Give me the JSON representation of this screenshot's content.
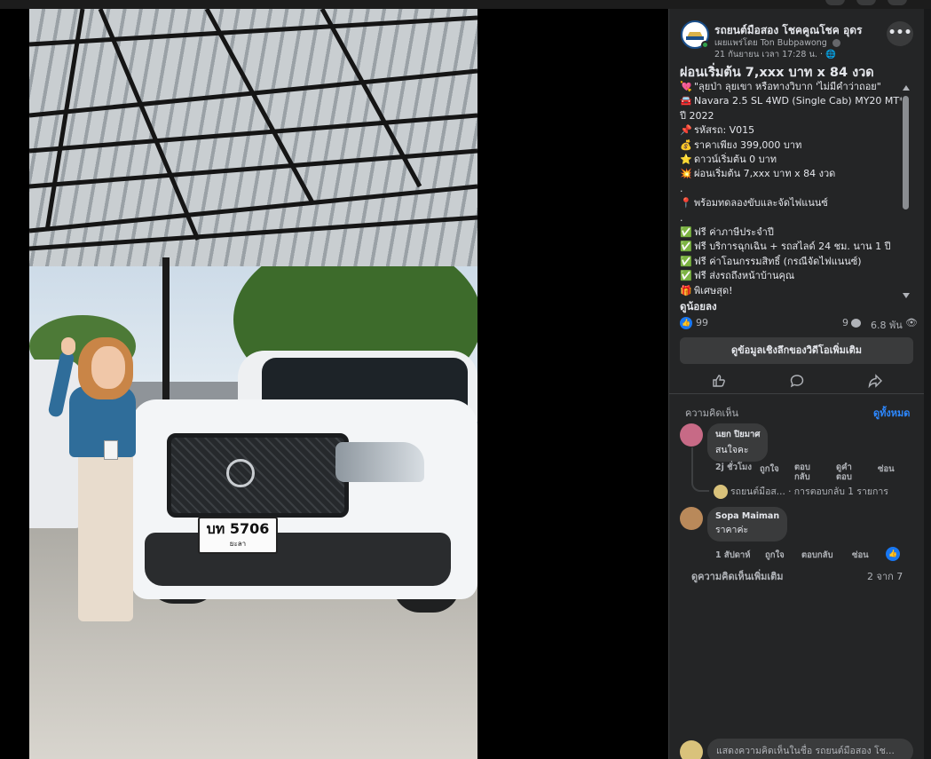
{
  "post": {
    "page_name": "รถยนต์มือสอง โชคคูณโชค อุดร",
    "published_by": "เผยแพร่โดย Ton Bubpawong",
    "timestamp": "21 กันยายน เวลา 17:28 น. ·",
    "title": "ผ่อนเริ่มต้น 7,xxx บาท x 84 งวด",
    "more_label": "•••",
    "see_less": "ดูน้อยลง",
    "lines": [
      {
        "icon": "💘",
        "text": "\"ลุยป่า ลุยเขา หรือทางวิบาก 'ไม่มีคำว่าถอย\""
      },
      {
        "icon": "🚘",
        "text": "Navara 2.5 SL 4WD (Single Cab) MY20 MT*"
      },
      {
        "icon": "",
        "text": "ปี 2022"
      },
      {
        "icon": "📌",
        "text": "รหัสรถ: V015"
      },
      {
        "icon": "💰",
        "text": "ราคาเพียง 399,000 บาท"
      },
      {
        "icon": "⭐",
        "text": "ดาวน์เริ่มต้น 0 บาท"
      },
      {
        "icon": "💥",
        "text": "ผ่อนเริ่มต้น 7,xxx บาท x 84 งวด"
      },
      {
        "icon": "",
        "text": "."
      },
      {
        "icon": "📍",
        "text": "พร้อมทดลองขับและจัดไฟแนนซ์"
      },
      {
        "icon": "",
        "text": "."
      },
      {
        "icon": "✅",
        "text": "ฟรี ค่าภาษีประจำปี"
      },
      {
        "icon": "✅",
        "text": "ฟรี บริการฉุกเฉิน + รถสไลด์ 24 ชม. นาน 1 ปี"
      },
      {
        "icon": "✅",
        "text": "ฟรี ค่าโอนกรรมสิทธิ์ (กรณีจัดไฟแนนซ์)"
      },
      {
        "icon": "✅",
        "text": "ฟรี ส่งรถถึงหน้าบ้านคุณ"
      },
      {
        "icon": "🎁",
        "text": "พิเศษสุด!"
      }
    ]
  },
  "stats": {
    "likes": "99",
    "comments": "9",
    "views": "6.8 พัน",
    "like_icon": "👍",
    "eye_icon": "👁"
  },
  "insight_button": "ดูข้อมูลเชิงลึกของวิดีโอเพิ่มเติม",
  "comments_section": {
    "header": "ความคิดเห็น",
    "see_all": "ดูทั้งหมด",
    "items": [
      {
        "name": "นยก ปิยมาศ",
        "text": "สนใจคะ",
        "meta": [
          "2j ชั่วโมง",
          "ถูกใจ",
          "ตอบกลับ",
          "ดูคำตอบ",
          "ซ่อน"
        ]
      },
      {
        "name": "Sopa Maiman",
        "text": "ราคาค่ะ",
        "meta": [
          "1 สัปดาห์",
          "ถูกใจ",
          "ตอบกลับ",
          "ซ่อน"
        ]
      }
    ],
    "reply_summary": "รถยนต์มือส... · การตอบกลับ 1 รายการ",
    "more_comments": "ดูความคิดเห็นเพิ่มเติม",
    "count": "2 จาก 7"
  },
  "composer": {
    "placeholder": "แสดงความคิดเห็นในชื่อ รถยนต์มือสอง โช..."
  },
  "video": {
    "plate_number": "บท 5706",
    "plate_province": "ยะลา"
  }
}
